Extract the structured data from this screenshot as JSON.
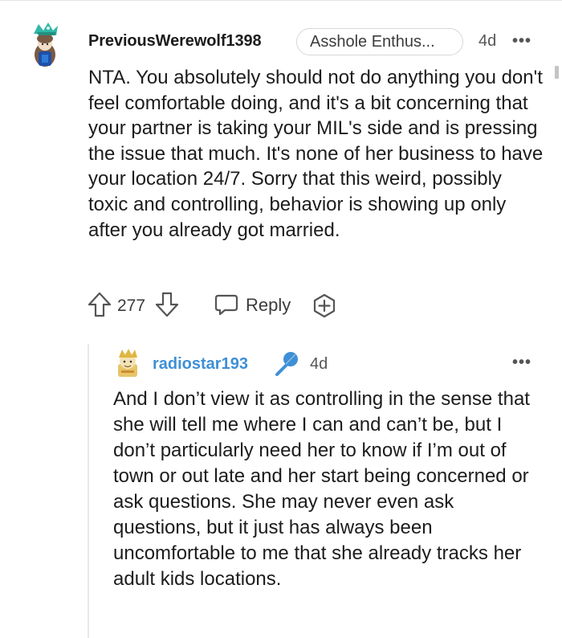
{
  "comment": {
    "author": "PreviousWerewolf1398",
    "flair": "Asshole Enthus...",
    "time": "4d",
    "more": "•••",
    "body": "NTA. You absolutely should not do anything you don't feel comfortable doing, and it's a bit concerning that your partner is taking your MIL's side and is pressing the issue that much. It's none of her business to have your location 24/7. Sorry that this weird, possibly toxic and controlling, behavior is showing up only after you already got married.",
    "score": "277",
    "reply_label": "Reply"
  },
  "reply": {
    "author": "radiostar193",
    "time": "4d",
    "more": "•••",
    "body": "And I don’t view it as controlling in the sense that she will tell me where I can and can’t be, but I don’t particularly need her to know if I’m out of town or out late and her start being concerned or ask questions. She may never even ask questions, but it just has always been uncomfortable to me that she already tracks her adult kids locations."
  },
  "colors": {
    "text": "#1c1c1c",
    "meta": "#555555",
    "reply_author": "#3f8fd6",
    "mic": "#3f8fd6",
    "thread_line": "#e8e8e8"
  },
  "icons": [
    "avatar-icon",
    "upvote-icon",
    "downvote-icon",
    "reply-icon",
    "award-icon",
    "microphone-icon",
    "more-options-icon"
  ]
}
